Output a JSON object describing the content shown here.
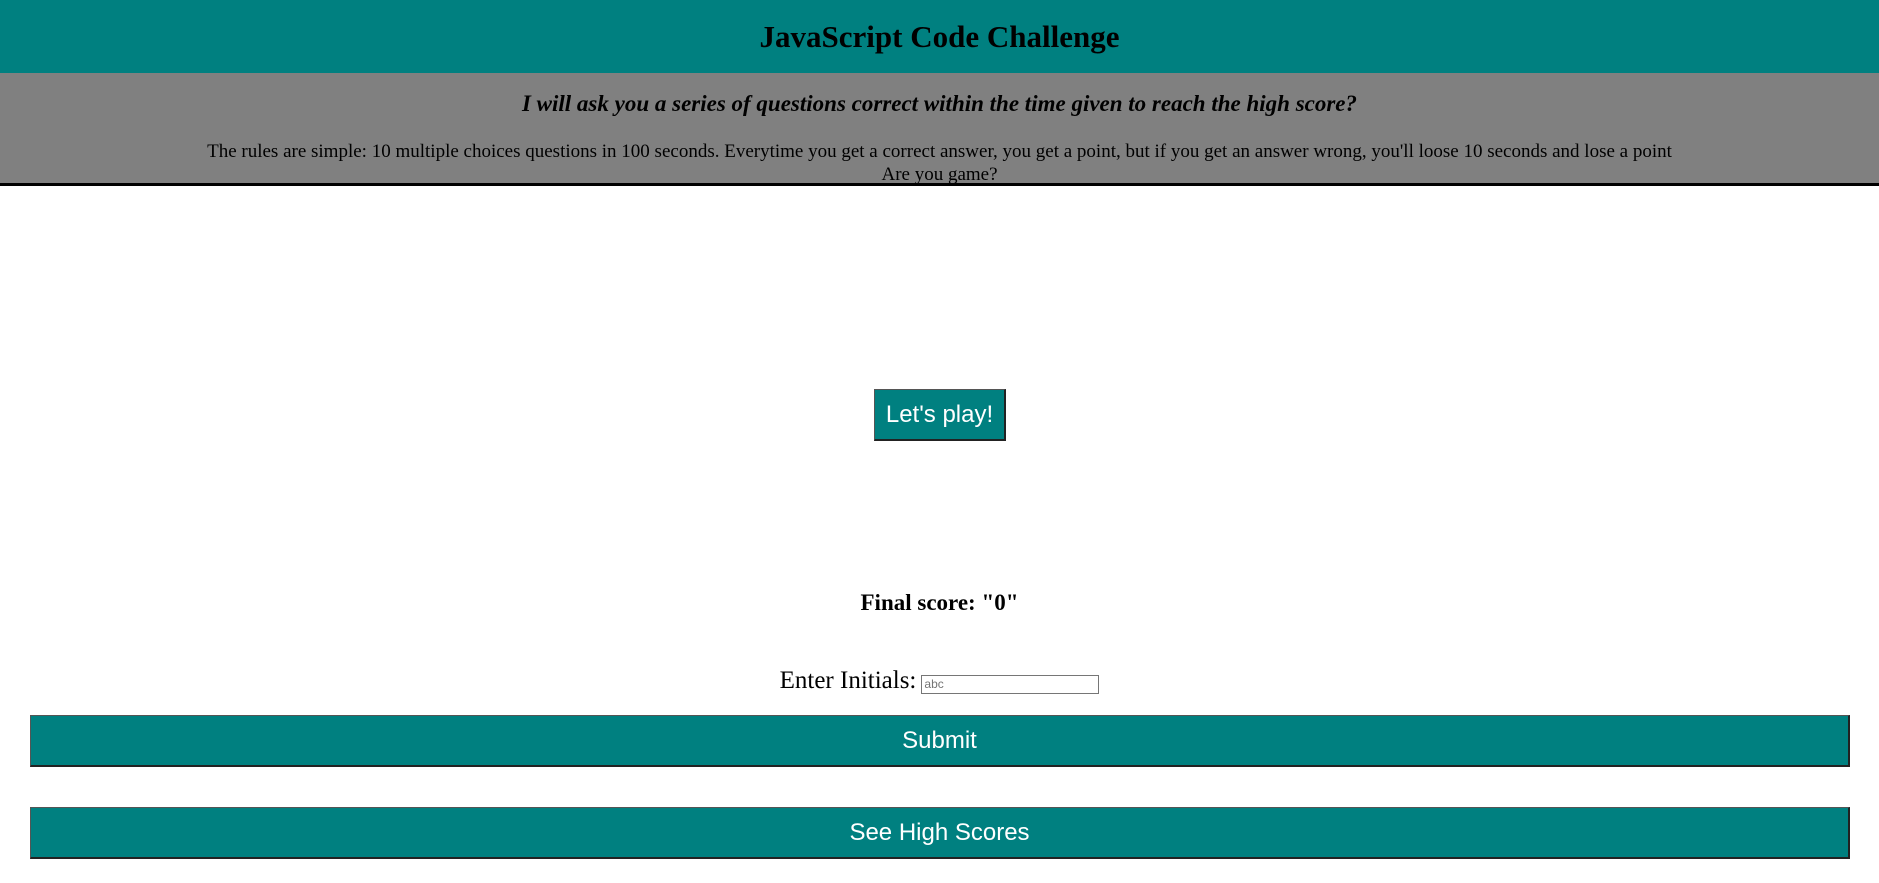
{
  "header": {
    "title": "JavaScript Code Challenge"
  },
  "intro": {
    "tagline": "I will ask you a series of questions correct within the time given to reach the high score?",
    "rules_line1": "The rules are simple: 10 multiple choices questions in 100 seconds. Everytime you get a correct answer, you get a point, but if you get an answer wrong, you'll loose 10 seconds and lose a point",
    "rules_line2": "Are you game?"
  },
  "start": {
    "play_label": "Let's play!"
  },
  "result": {
    "final_score_label": "Final score: \"0\"",
    "initials_label": "Enter Initials:",
    "initials_value": "",
    "initials_placeholder": "abc",
    "submit_label": "Submit",
    "high_scores_label": "See High Scores"
  },
  "colors": {
    "accent": "#008080",
    "intro_bg": "#808080"
  }
}
